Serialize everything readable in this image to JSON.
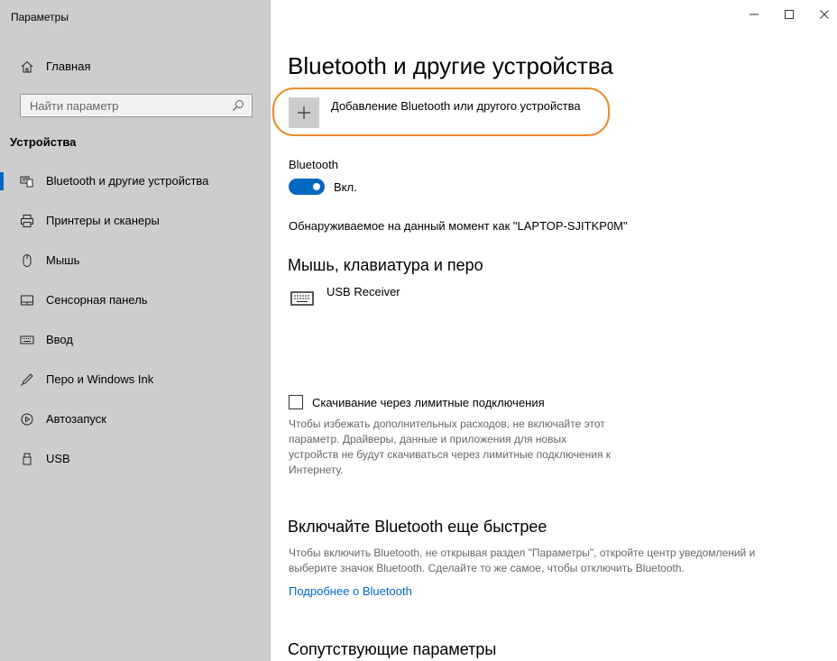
{
  "window": {
    "title": "Параметры",
    "minimize_icon": "minimize-icon",
    "maximize_icon": "maximize-icon",
    "close_icon": "close-icon"
  },
  "sidebar": {
    "home_label": "Главная",
    "search_placeholder": "Найти параметр",
    "section_title": "Устройства",
    "items": [
      {
        "label": "Bluetooth и другие устройства",
        "icon": "bluetooth-devices-icon",
        "selected": true
      },
      {
        "label": "Принтеры и сканеры",
        "icon": "printer-icon",
        "selected": false
      },
      {
        "label": "Мышь",
        "icon": "mouse-icon",
        "selected": false
      },
      {
        "label": "Сенсорная панель",
        "icon": "touchpad-icon",
        "selected": false
      },
      {
        "label": "Ввод",
        "icon": "keyboard-icon",
        "selected": false
      },
      {
        "label": "Перо и Windows Ink",
        "icon": "pen-icon",
        "selected": false
      },
      {
        "label": "Автозапуск",
        "icon": "autoplay-icon",
        "selected": false
      },
      {
        "label": "USB",
        "icon": "usb-icon",
        "selected": false
      }
    ]
  },
  "main": {
    "title": "Bluetooth и другие устройства",
    "add_device_label": "Добавление Bluetooth или другого устройства",
    "bluetooth_label": "Bluetooth",
    "bluetooth_state": "Вкл.",
    "discoverable_text": "Обнаруживаемое на данный момент как \"LAPTOP-SJITKP0M\"",
    "mouse_section_title": "Мышь, клавиатура и перо",
    "device_name": "USB Receiver",
    "metered_label": "Скачивание через лимитные подключения",
    "metered_desc_1": "Чтобы избежать дополнительных расходов, не включайте этот",
    "metered_desc_2": "параметр. Драйверы, данные и приложения для новых",
    "metered_desc_3": "устройств не будут скачиваться через лимитные подключения к",
    "metered_desc_4": "Интернету.",
    "faster_title": "Включайте Bluetooth еще быстрее",
    "faster_desc_1": "Чтобы включить Bluetooth, не открывая раздел \"Параметры\", откройте центр уведомлений и",
    "faster_desc_2": "выберите значок Bluetooth. Сделайте то же самое, чтобы отключить Bluetooth.",
    "faster_link": "Подробнее о Bluetooth",
    "related_title": "Сопутствующие параметры"
  },
  "colors": {
    "accent": "#0067c0",
    "highlight": "#ee8a2a",
    "sidebar_bg": "#cdcdcd"
  }
}
